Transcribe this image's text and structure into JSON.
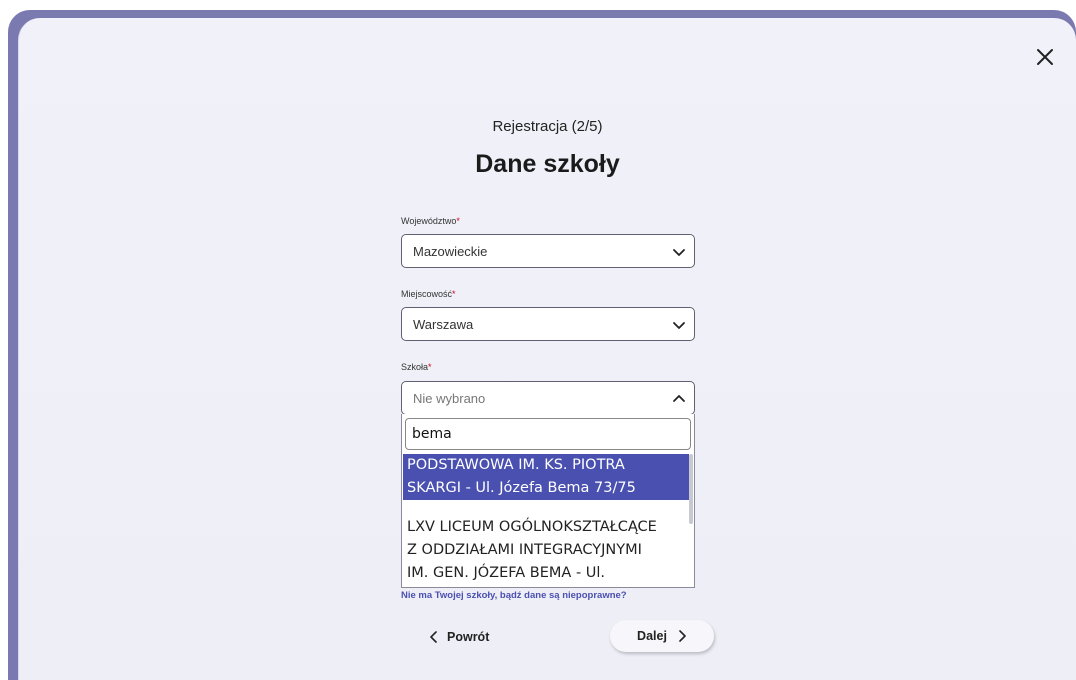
{
  "header": {
    "step": "Rejestracja (2/5)",
    "title": "Dane szkoły"
  },
  "fields": {
    "voivodeship": {
      "label": "Województwo",
      "required_mark": "*",
      "value": "Mazowieckie"
    },
    "city": {
      "label": "Miejscowość",
      "required_mark": "*",
      "value": "Warszawa"
    },
    "school": {
      "label": "Szkoła",
      "required_mark": "*",
      "placeholder": "Nie wybrano",
      "search_value": "bema",
      "options": [
        {
          "line1": "PODSTAWOWA IM. KS. PIOTRA",
          "line2": "SKARGI - Ul. Józefa Bema 73/75",
          "selected": true
        },
        {
          "line1": "LXV LICEUM OGÓLNOKSZTAŁCĄCE",
          "line2": "Z ODDZIAŁAMI INTEGRACYJNYMI",
          "line3": "IM. GEN. JÓZEFA BEMA - Ul.",
          "selected": false
        }
      ]
    }
  },
  "help_link": "Nie ma Twojej szkoły, bądź dane są niepoprawne?",
  "buttons": {
    "back": "Powrót",
    "next": "Dalej"
  },
  "icons": {
    "close": "close-icon",
    "chevron_down": "chevron-down-icon",
    "chevron_up": "chevron-up-icon",
    "chevron_left": "chevron-left-icon",
    "chevron_right": "chevron-right-icon"
  },
  "colors": {
    "accent": "#4a50b0",
    "required": "#d0021b",
    "backdrop": "#7a7ab0"
  }
}
